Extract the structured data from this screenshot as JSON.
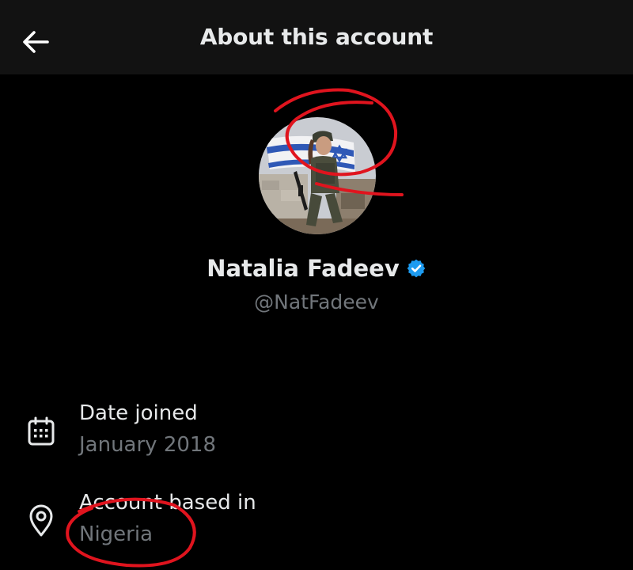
{
  "header": {
    "title": "About this account",
    "back_icon": "arrow-left-icon"
  },
  "profile": {
    "display_name": "Natalia Fadeev",
    "handle": "@NatFadeev",
    "verified_icon": "verified-badge-icon",
    "verified_color": "#1d9bf0"
  },
  "details": {
    "date_joined": {
      "label": "Date joined",
      "value": "January 2018",
      "icon": "calendar-icon"
    },
    "based_in": {
      "label": "Account based in",
      "value": "Nigeria",
      "icon": "location-pin-icon"
    }
  },
  "annotations": {
    "color": "#e0141e"
  },
  "colors": {
    "background": "#000000",
    "header_background": "#121212",
    "primary_text": "#e7e9ea",
    "secondary_text": "#71767b"
  }
}
